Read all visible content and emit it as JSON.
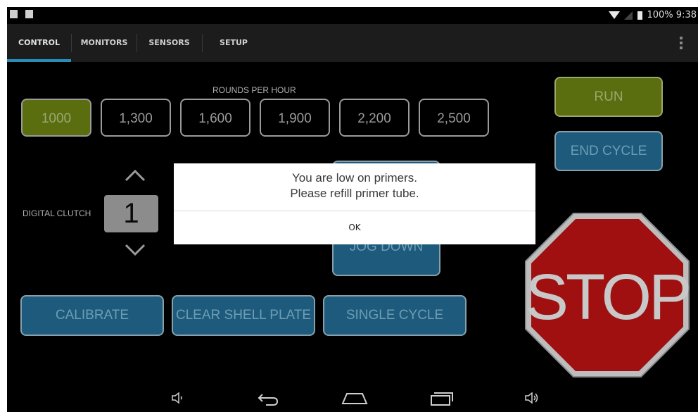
{
  "status_bar": {
    "battery": "100%",
    "time": "9:38",
    "left_icons": [
      "usb-debug-icon",
      "image-icon"
    ],
    "right_icons": [
      "wifi-icon",
      "signal-icon",
      "battery-icon"
    ]
  },
  "tabs": [
    {
      "label": "CONTROL",
      "selected": true
    },
    {
      "label": "MONITORS",
      "selected": false
    },
    {
      "label": "SENSORS",
      "selected": false
    },
    {
      "label": "SETUP",
      "selected": false
    }
  ],
  "control": {
    "rounds_per_hour_label": "ROUNDS PER HOUR",
    "rph_options": [
      "1000",
      "1,300",
      "1,600",
      "1,900",
      "2,200",
      "2,500"
    ],
    "rph_selected": "1000",
    "run_label": "RUN",
    "end_cycle_label": "END CYCLE",
    "jog_down_label": "JOG DOWN",
    "digital_clutch_label": "DIGITAL CLUTCH",
    "digital_clutch_value": "1",
    "calibrate_label": "CALIBRATE",
    "clear_shell_plate_label": "CLEAR SHELL PLATE",
    "single_cycle_label": "SINGLE CYCLE",
    "stop_label": "STOP"
  },
  "dialog": {
    "message_line1": "You are low on primers.",
    "message_line2": "Please refill primer tube.",
    "ok_label": "OK"
  },
  "navbar": {
    "icons": [
      "volume-down-icon",
      "back-icon",
      "home-icon",
      "recent-apps-icon",
      "volume-up-icon"
    ]
  },
  "colors": {
    "accent_blue": "#2a8db5",
    "button_blue": "#1d5a7c",
    "button_green": "#5a6e10",
    "stop_red": "#a01010"
  }
}
